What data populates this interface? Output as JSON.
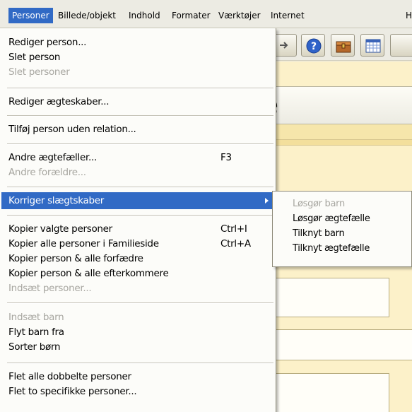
{
  "menubar": {
    "items": [
      "Personer",
      "Billede/objekt",
      "Indhold",
      "Formater",
      "Værktøjer",
      "Internet",
      "H"
    ],
    "active_index": 0
  },
  "toolbar": {
    "icons": [
      "arrow-dropdown-icon",
      "help-icon",
      "treasure-box-icon",
      "calendar-icon"
    ]
  },
  "title_box": {
    "text": "e"
  },
  "menu": {
    "items": [
      {
        "label": "Rediger person...",
        "enabled": true
      },
      {
        "label": "Slet person",
        "enabled": true
      },
      {
        "label": "Slet personer",
        "enabled": false
      },
      {
        "label": "Rediger ægteskaber...",
        "enabled": true
      },
      {
        "label": "Tilføj person uden relation...",
        "enabled": true
      },
      {
        "label": "Andre ægtefæller...",
        "shortcut": "F3",
        "enabled": true
      },
      {
        "label": "Andre forældre...",
        "enabled": false
      },
      {
        "label": "Korriger slægtskaber",
        "enabled": true,
        "highlighted": true,
        "has_submenu": true
      },
      {
        "label": "Kopier valgte personer",
        "shortcut": "Ctrl+I",
        "enabled": true
      },
      {
        "label": "Kopier alle personer i Familieside",
        "shortcut": "Ctrl+A",
        "enabled": true
      },
      {
        "label": "Kopier person & alle forfædre",
        "enabled": true
      },
      {
        "label": "Kopier person & alle efterkommere",
        "enabled": true
      },
      {
        "label": "Indsæt personer...",
        "enabled": false
      },
      {
        "label": "Indsæt barn",
        "enabled": false
      },
      {
        "label": "Flyt barn fra",
        "enabled": true
      },
      {
        "label": "Sorter børn",
        "enabled": true
      },
      {
        "label": "Flet alle dobbelte personer",
        "enabled": true
      },
      {
        "label": "Flet to specifikke personer...",
        "enabled": true
      }
    ]
  },
  "submenu": {
    "items": [
      {
        "label": "Løsgør barn",
        "enabled": false
      },
      {
        "label": "Løsgør ægtefælle",
        "enabled": true
      },
      {
        "label": "Tilknyt barn",
        "enabled": true
      },
      {
        "label": "Tilknyt ægtefælle",
        "enabled": true
      }
    ]
  },
  "colors": {
    "highlight": "#316ac5",
    "menu_background": "#fcfcf9",
    "disabled_text": "#a7a6a0",
    "content_background": "#fcf1c9"
  }
}
